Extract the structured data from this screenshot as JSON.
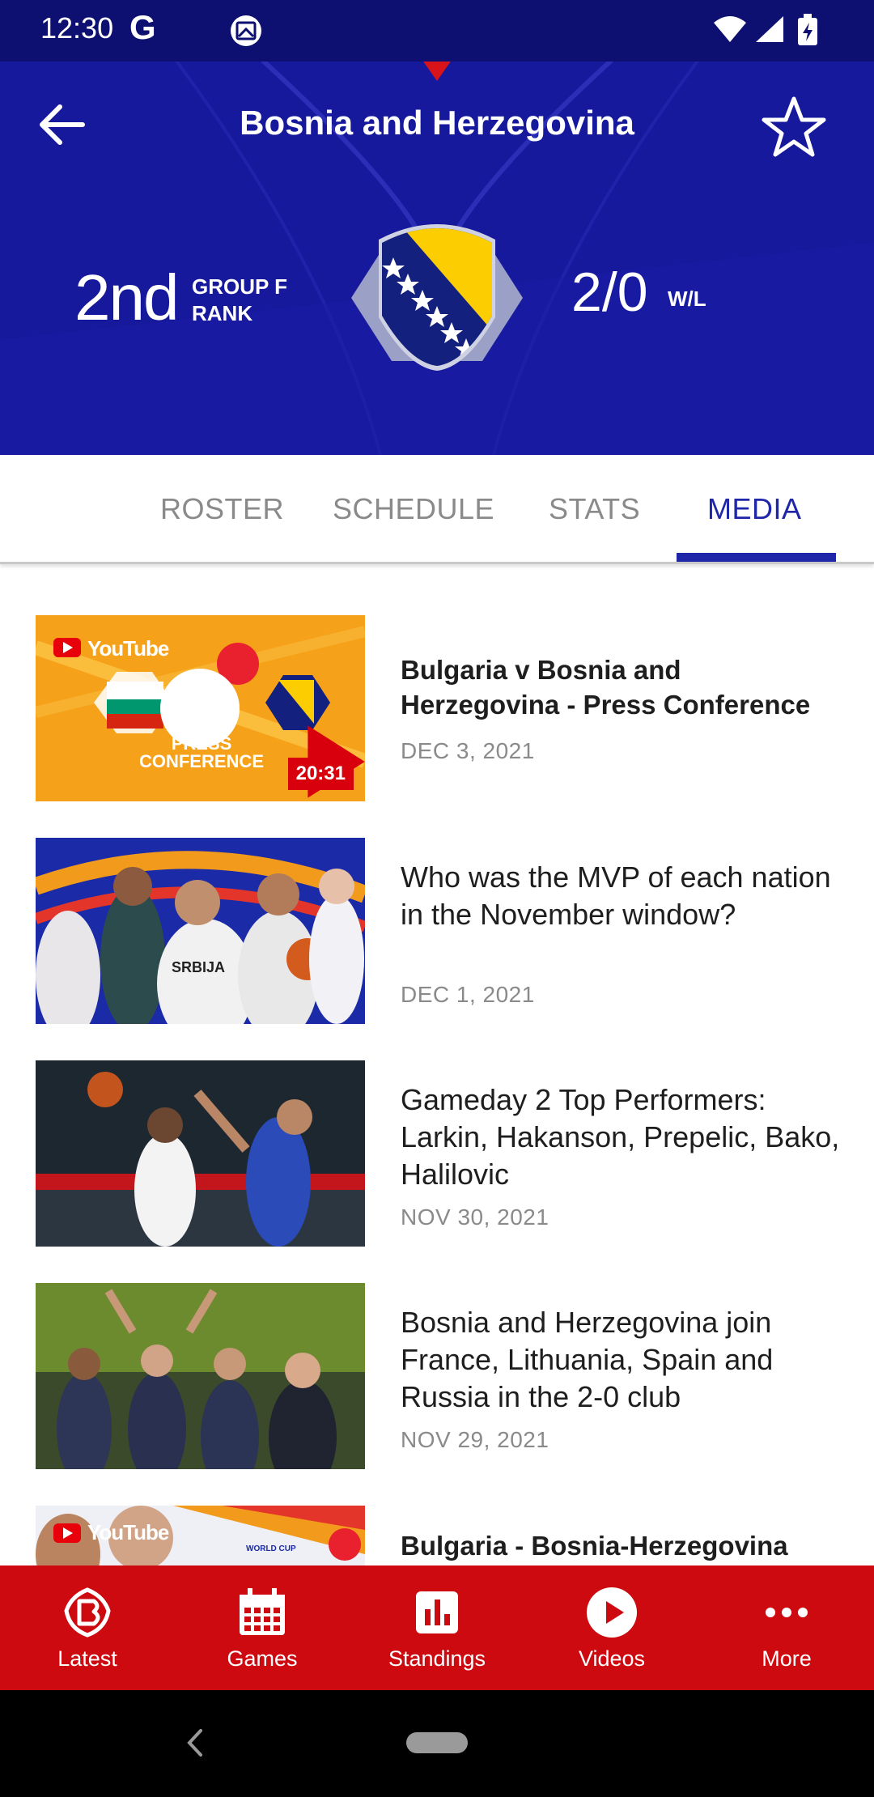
{
  "status_bar": {
    "time": "12:30",
    "g_label": "G"
  },
  "header": {
    "title": "Bosnia and Herzegovina",
    "rank_value": "2nd",
    "rank_label_line1": "GROUP F",
    "rank_label_line2": "RANK",
    "record_value": "2/0",
    "record_label": "W/L",
    "favorite": false,
    "colors": {
      "background": "#17199c",
      "crest_yellow": "#fccd00",
      "crest_blue": "#14207e"
    }
  },
  "tabs": [
    {
      "label": "ROSTER",
      "active": false
    },
    {
      "label": "SCHEDULE",
      "active": false
    },
    {
      "label": "STATS",
      "active": false
    },
    {
      "label": "MEDIA",
      "active": true
    }
  ],
  "media": [
    {
      "title": "Bulgaria v Bosnia and Herzegovina - Press Conference",
      "date": "DEC 3, 2021",
      "duration": "20:31",
      "thumb_text_youtube": "YouTube",
      "thumb_text_press": "PRESS CONFERENCE",
      "video": true
    },
    {
      "title": "Who was the MVP of each nation in the November window?",
      "date": "DEC 1, 2021",
      "thumb_text_jersey": "SRBIJA"
    },
    {
      "title": "Gameday 2 Top Performers: Larkin, Hakanson, Prepelic, Bako, Halilovic",
      "date": "NOV 30, 2021"
    },
    {
      "title": "Bosnia and Herzegovina join France, Lithuania, Spain and Russia in the 2-0 club",
      "date": "NOV 29, 2021"
    },
    {
      "title": "Bulgaria - Bosnia-Herzegovina",
      "thumb_text_youtube": "YouTube",
      "thumb_text_event": "WORLD CUP"
    }
  ],
  "bottom_nav": [
    {
      "label": "Latest",
      "icon": "fiba-logo-icon"
    },
    {
      "label": "Games",
      "icon": "calendar-icon"
    },
    {
      "label": "Standings",
      "icon": "bar-chart-icon"
    },
    {
      "label": "Videos",
      "icon": "play-circle-icon"
    },
    {
      "label": "More",
      "icon": "more-dots-icon"
    }
  ],
  "theme": {
    "accent_red": "#cd0a10",
    "tab_active": "#2026a8",
    "tab_inactive": "#8a8a8a"
  }
}
